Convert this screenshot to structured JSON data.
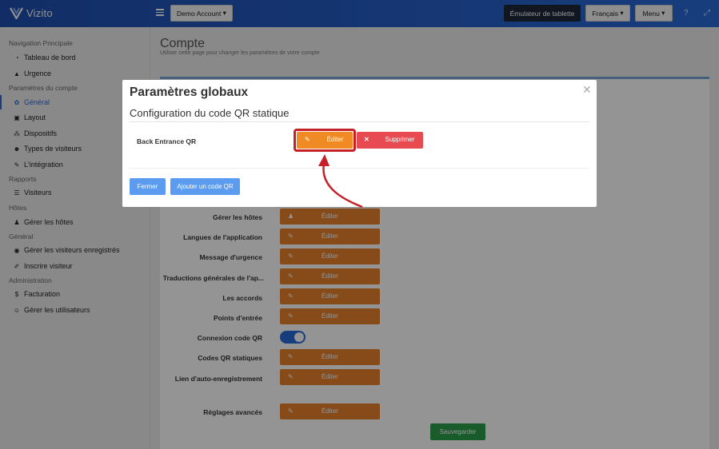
{
  "app": {
    "name": "Vizito"
  },
  "topbar": {
    "account_label": "Demo Account",
    "tablet_label": "Émulateur de tablette",
    "language_label": "Français",
    "menu_label": "Menu"
  },
  "sidebar": {
    "sections": [
      {
        "label": "Navigation Principale"
      },
      {
        "label": "Paramètres du compte"
      },
      {
        "label": "Rapports"
      },
      {
        "label": "Hôtes"
      },
      {
        "label": "Général"
      },
      {
        "label": "Administration"
      }
    ],
    "items": [
      {
        "label": "Tableau de bord",
        "icon": "dashboard-icon"
      },
      {
        "label": "Urgence",
        "icon": "warning-icon"
      },
      {
        "label": "Général",
        "icon": "gear-icon",
        "active": true
      },
      {
        "label": "Layout",
        "icon": "image-icon"
      },
      {
        "label": "Dispositifs",
        "icon": "sitemap-icon"
      },
      {
        "label": "Types de visiteurs",
        "icon": "users-icon"
      },
      {
        "label": "L'intégration",
        "icon": "wrench-icon"
      },
      {
        "label": "Visiteurs",
        "icon": "list-icon"
      },
      {
        "label": "Gérer les hôtes",
        "icon": "user-tie-icon"
      },
      {
        "label": "Gérer les visiteurs enregistrés",
        "icon": "user-circle-icon"
      },
      {
        "label": "Inscrire visiteur",
        "icon": "pencil-icon"
      },
      {
        "label": "Facturation",
        "icon": "dollar-icon"
      },
      {
        "label": "Gérer les utilisateurs",
        "icon": "user-plus-icon"
      }
    ]
  },
  "main": {
    "title": "Compte",
    "subtitle": "Utiliser cette page pour changer les paramètres de votre compte",
    "rows": [
      {
        "label": "Gérer les hôtes",
        "button": "Éditer",
        "icon": "user-tie-icon"
      },
      {
        "label": "Langues de l'application",
        "button": "Éditer",
        "icon": "edit-icon"
      },
      {
        "label": "Message d'urgence",
        "button": "Éditer",
        "icon": "edit-icon"
      },
      {
        "label": "Traductions générales de l'ap...",
        "button": "Éditer",
        "icon": "edit-icon"
      },
      {
        "label": "Les accords",
        "button": "Éditer",
        "icon": "edit-icon"
      },
      {
        "label": "Points d'entrée",
        "button": "Éditer",
        "icon": "edit-icon"
      },
      {
        "label": "Connexion code QR",
        "toggle": true
      },
      {
        "label": "Codes QR statiques",
        "button": "Éditer",
        "icon": "edit-icon"
      },
      {
        "label": "Lien d'auto-enregistrement",
        "button": "Éditer",
        "icon": "edit-icon"
      },
      {
        "label": "Réglages avancés",
        "button": "Éditer",
        "icon": "edit-icon"
      }
    ],
    "save_label": "Sauvegarder"
  },
  "modal": {
    "title": "Paramètres globaux",
    "subtitle": "Configuration du code QR statique",
    "qr_name": "Back Entrance QR",
    "edit_label": "Éditer",
    "delete_label": "Supprimer",
    "close_label": "Fermer",
    "add_label": "Ajouter un code QR"
  },
  "colors": {
    "brand": "#2a6ad8",
    "edit": "#e8812b",
    "delete": "#e84a51",
    "save": "#2e9e4a",
    "highlight": "#c62028"
  }
}
